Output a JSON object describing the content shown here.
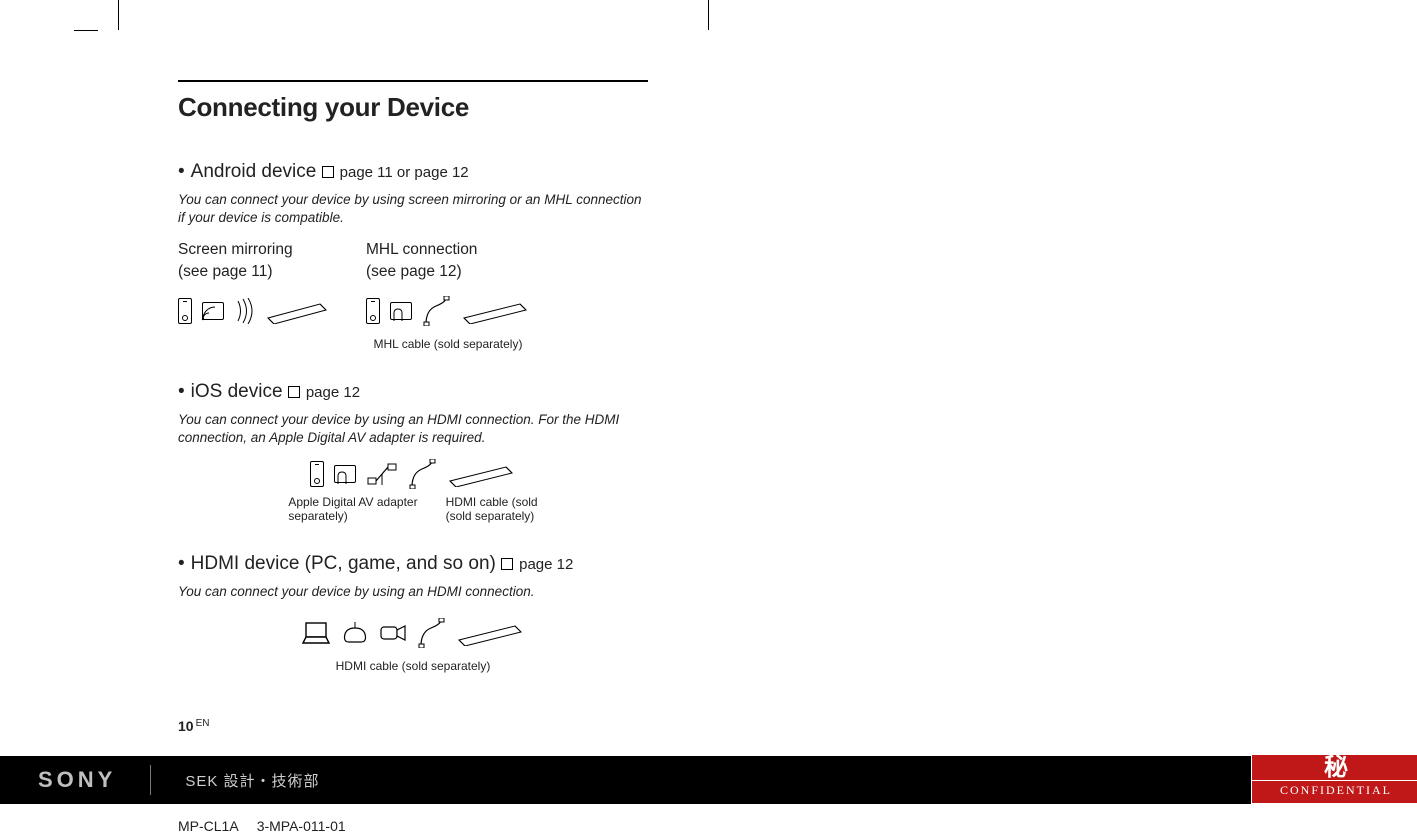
{
  "heading": "Connecting your Device",
  "android": {
    "title": "Android device",
    "pageref": "page 11 or page 12",
    "desc": "You can connect your device by using screen mirroring or an MHL connection if your device is compatible.",
    "col1_title": "Screen mirroring",
    "col1_sub": "(see page 11)",
    "col2_title": "MHL connection",
    "col2_sub": "(see page 12)",
    "mhl_caption": "MHL cable (sold separately)"
  },
  "ios": {
    "title": "iOS device",
    "pageref": "page 12",
    "desc": "You can connect your device by using an HDMI connection. For the HDMI connection, an Apple Digital AV adapter is required.",
    "adapter_caption": "Apple Digital AV adapter\nseparately)",
    "hdmi_caption": "HDMI cable (sold\n(sold separately)"
  },
  "hdmi": {
    "title": "HDMI device (PC, game, and so on)",
    "pageref": "page 12",
    "desc": "You can connect your device by using an HDMI connection.",
    "caption": "HDMI cable (sold separately)"
  },
  "page_number": "10",
  "page_lang": "EN",
  "footer": {
    "brand": "SONY",
    "dept": "SEK 設計・技術部",
    "confidential_kanji": "秘",
    "confidential_eng": "CONFIDENTIAL"
  },
  "docid": {
    "model": "MP-CL1A",
    "code": "3-MPA-011-01"
  }
}
